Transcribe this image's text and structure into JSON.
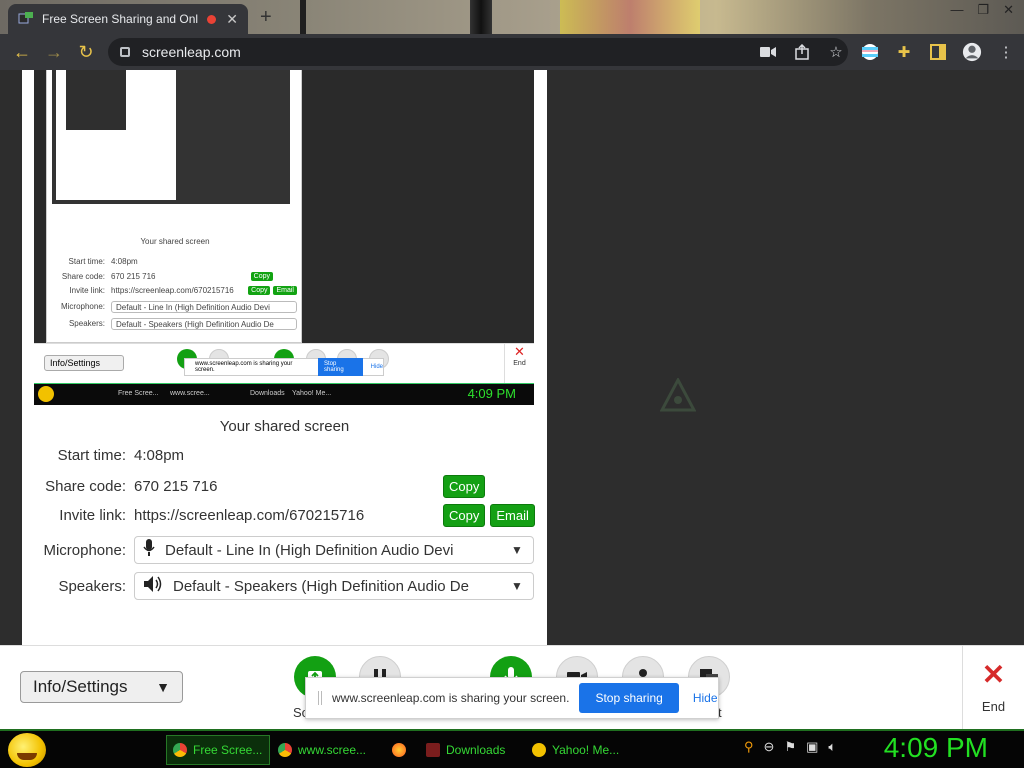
{
  "browser": {
    "tab_title": "Free Screen Sharing and Onl",
    "tab_close": "✕",
    "new_tab": "+",
    "url": "screenleap.com",
    "back": "←",
    "forward": "→",
    "reload": "↻",
    "window_controls": [
      "—",
      "❐",
      "✕"
    ],
    "toolbar_icons": [
      "camera-icon",
      "share-icon",
      "star-icon",
      "profile-flag-icon",
      "extensions-icon",
      "sidepanel-icon",
      "avatar-icon",
      "menu-icon"
    ]
  },
  "nested_preview": {
    "shared_title": "Your shared screen",
    "start_label": "Start time:",
    "start_value": "4:08pm",
    "share_label": "Share code:",
    "share_value": "670 215 716",
    "invite_label": "Invite link:",
    "invite_value": "https://screenleap.com/670215716",
    "mic_label": "Microphone:",
    "mic_value": "Default - Line In (High Definition Audio Devi",
    "speakers_label": "Speakers:",
    "speakers_value": "Default - Speakers (High Definition Audio De",
    "copy": "Copy",
    "email": "Email",
    "info_settings": "Info/Settings",
    "notify_text": "www.screenleap.com is sharing your screen.",
    "stop_sharing": "Stop sharing",
    "hide": "Hide",
    "end": "End",
    "taskbar_items": [
      "Free Scree...",
      "www.scree...",
      "Downloads",
      "Yahoo! Me..."
    ],
    "clock": "4:09 PM"
  },
  "panel": {
    "shared_title": "Your shared screen",
    "start_label": "Start time:",
    "start_value": "4:08pm",
    "share_label": "Share code:",
    "share_value": "670 215 716",
    "invite_label": "Invite link:",
    "invite_value": "https://screenleap.com/670215716",
    "copy_label": "Copy",
    "email_label": "Email",
    "mic_label": "Microphone:",
    "mic_value": "Default - Line In (High Definition Audio Devi",
    "speakers_label": "Speakers:",
    "speakers_value": "Default - Speakers (High Definition Audio De"
  },
  "controls": {
    "info_settings": "Info/Settings",
    "left_label_fragment": "So",
    "right_label_fragment": "t",
    "end_label": "End",
    "end_icon": "✕"
  },
  "notification": {
    "text": "www.screenleap.com is sharing your screen.",
    "stop_sharing": "Stop sharing",
    "hide": "Hide"
  },
  "taskbar": {
    "items": [
      "Free Scree...",
      "www.scree...",
      "Downloads",
      "Yahoo! Me..."
    ],
    "clock": "4:09 PM"
  },
  "colors": {
    "accent_green": "#14a014",
    "stop_blue": "#1a73e8",
    "end_red": "#d62a2a",
    "clock_green": "#22e022"
  }
}
